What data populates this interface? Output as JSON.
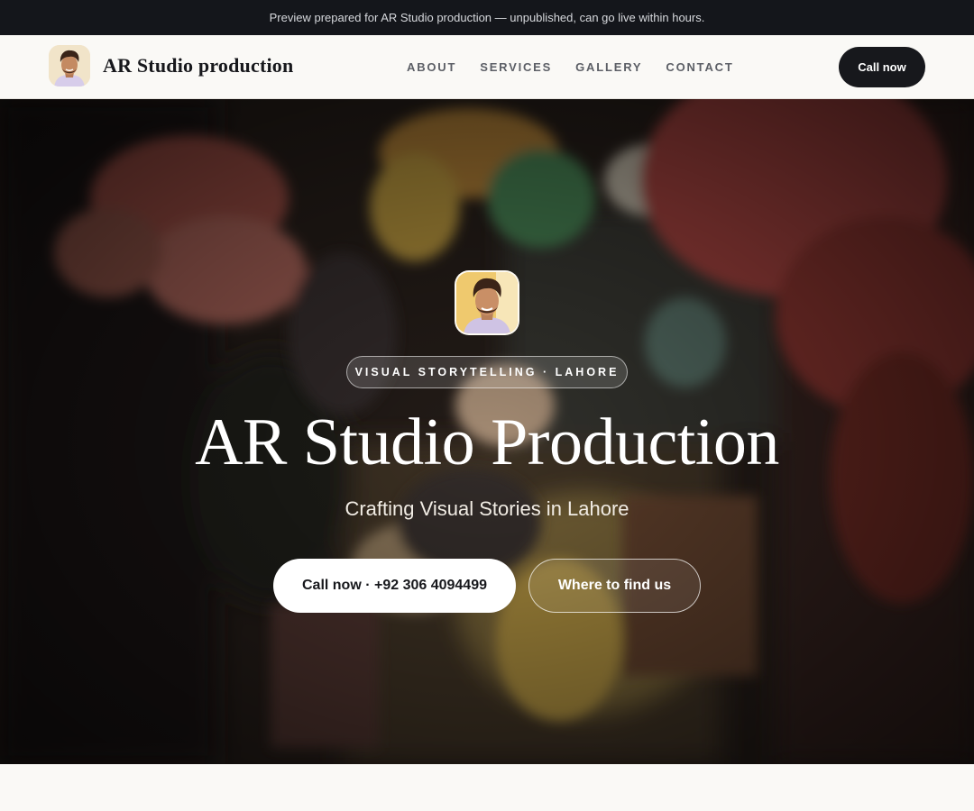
{
  "banner": {
    "text": "Preview prepared for AR Studio production — unpublished, can go live within hours."
  },
  "navbar": {
    "brand_name": "AR Studio production",
    "links": [
      "ABOUT",
      "SERVICES",
      "GALLERY",
      "CONTACT"
    ],
    "cta_label": "Call now"
  },
  "hero": {
    "eyebrow": "VISUAL STORYTELLING · LAHORE",
    "title": "AR Studio Production",
    "subtitle": "Crafting Visual Stories in Lahore",
    "primary_button": "Call now · +92 306 4094499",
    "secondary_button": "Where to find us"
  },
  "colors": {
    "banner_bg": "#14161b",
    "nav_bg": "#faf9f6",
    "dark_button": "#17181c",
    "hero_text": "#ffffff"
  },
  "icons": {
    "brand_logo": "profile-photo",
    "hero_avatar": "profile-photo"
  }
}
